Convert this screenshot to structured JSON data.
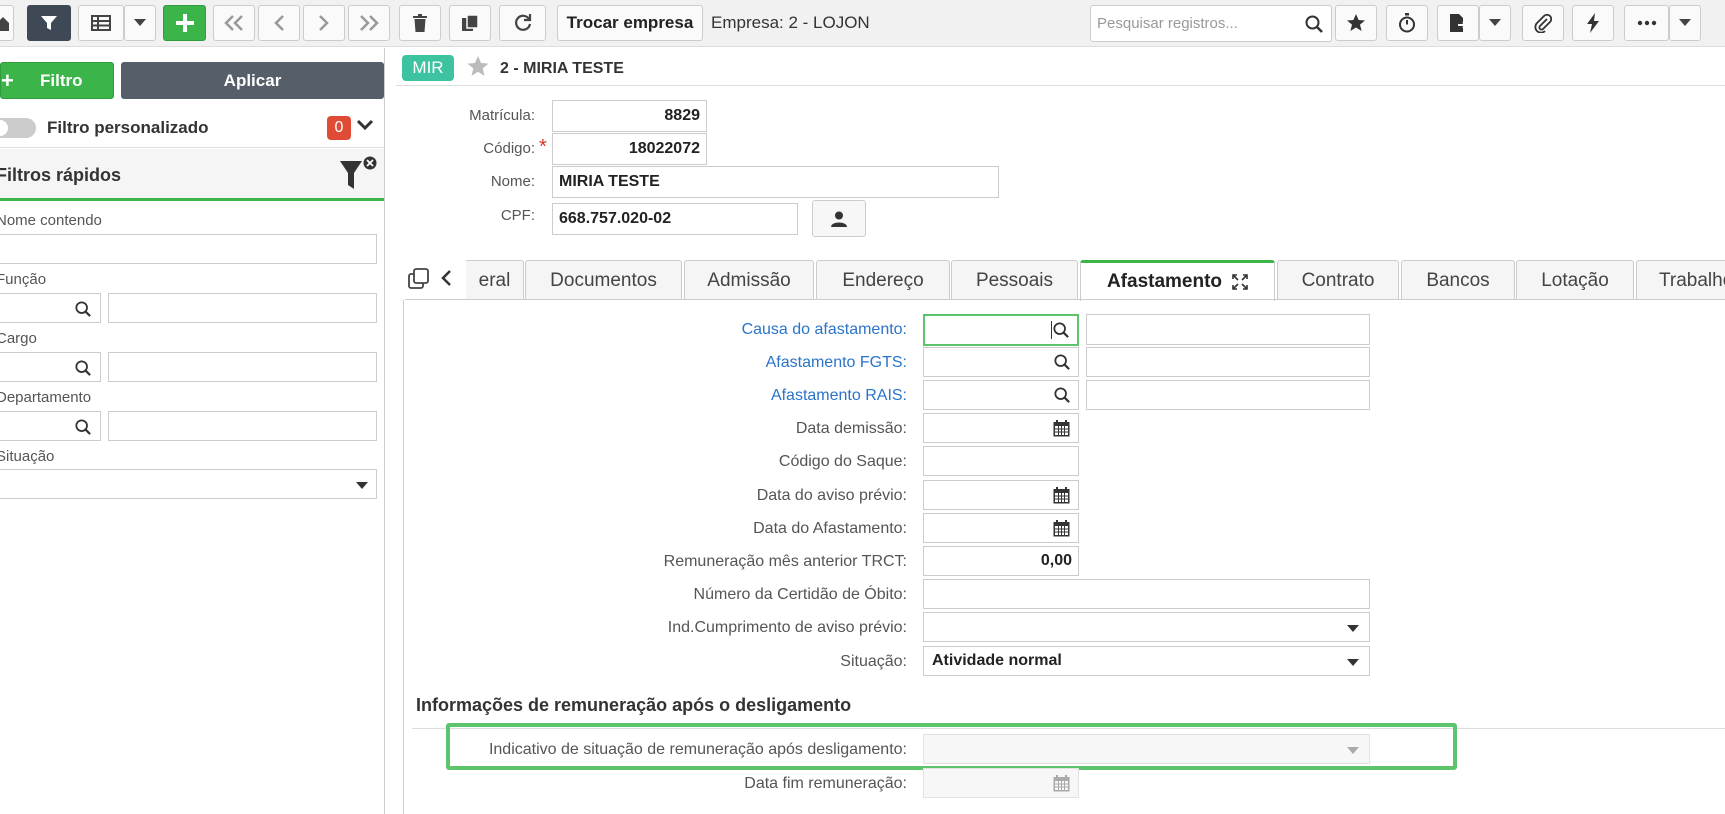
{
  "toolbar": {
    "trocar_empresa": "Trocar empresa",
    "empresa_label": "Empresa: 2 - LOJON",
    "search_placeholder": "Pesquisar registros..."
  },
  "sidebar": {
    "filtro_button": "Filtro",
    "filtro_plus": "+",
    "aplicar_button": "Aplicar",
    "custom_filter_label": "Filtro personalizado",
    "custom_filter_count": "0",
    "quick_filters_title": "Filtros rápidos",
    "nome_label": "Nome contendo",
    "funcao_label": "Função",
    "cargo_label": "Cargo",
    "departamento_label": "Departamento",
    "situacao_label": "Situação"
  },
  "record": {
    "badge": "MIR",
    "title": "2 - MIRIA TESTE"
  },
  "header_fields": {
    "matricula_label": "Matrícula:",
    "matricula_value": "8829",
    "codigo_label": "Código:",
    "codigo_value": "18022072",
    "required_mark": "*",
    "nome_label": "Nome:",
    "nome_value": "MIRIA TESTE",
    "cpf_label": "CPF:",
    "cpf_value": "668.757.020-02"
  },
  "tabs": [
    "eral",
    "Documentos",
    "Admissão",
    "Endereço",
    "Pessoais",
    "Afastamento",
    "Contrato",
    "Bancos",
    "Lotação",
    "Trabalho"
  ],
  "active_tab": "Afastamento",
  "form": {
    "causa_label": "Causa do afastamento:",
    "fgts_label": "Afastamento FGTS:",
    "rais_label": "Afastamento RAIS:",
    "data_demissao_label": "Data demissão:",
    "codigo_saque_label": "Código do Saque:",
    "data_aviso_label": "Data do aviso prévio:",
    "data_afastamento_label": "Data do Afastamento:",
    "remuneracao_label": "Remuneração mês anterior TRCT:",
    "remuneracao_value": "0,00",
    "certidao_label": "Número da Certidão de Óbito:",
    "ind_cumprimento_label": "Ind.Cumprimento de aviso prévio:",
    "situacao_label": "Situação:",
    "situacao_value": "Atividade normal",
    "section_title": "Informações de remuneração após o desligamento",
    "indicativo_label": "Indicativo de situação de remuneração após desligamento:",
    "data_fim_label": "Data fim remuneração:"
  },
  "colors": {
    "green": "#3bb54a",
    "dark": "#3f4955",
    "link": "#2a74c9",
    "badge_red": "#e04b35",
    "teal": "#3ec3a0",
    "highlight": "#5cc46a"
  }
}
